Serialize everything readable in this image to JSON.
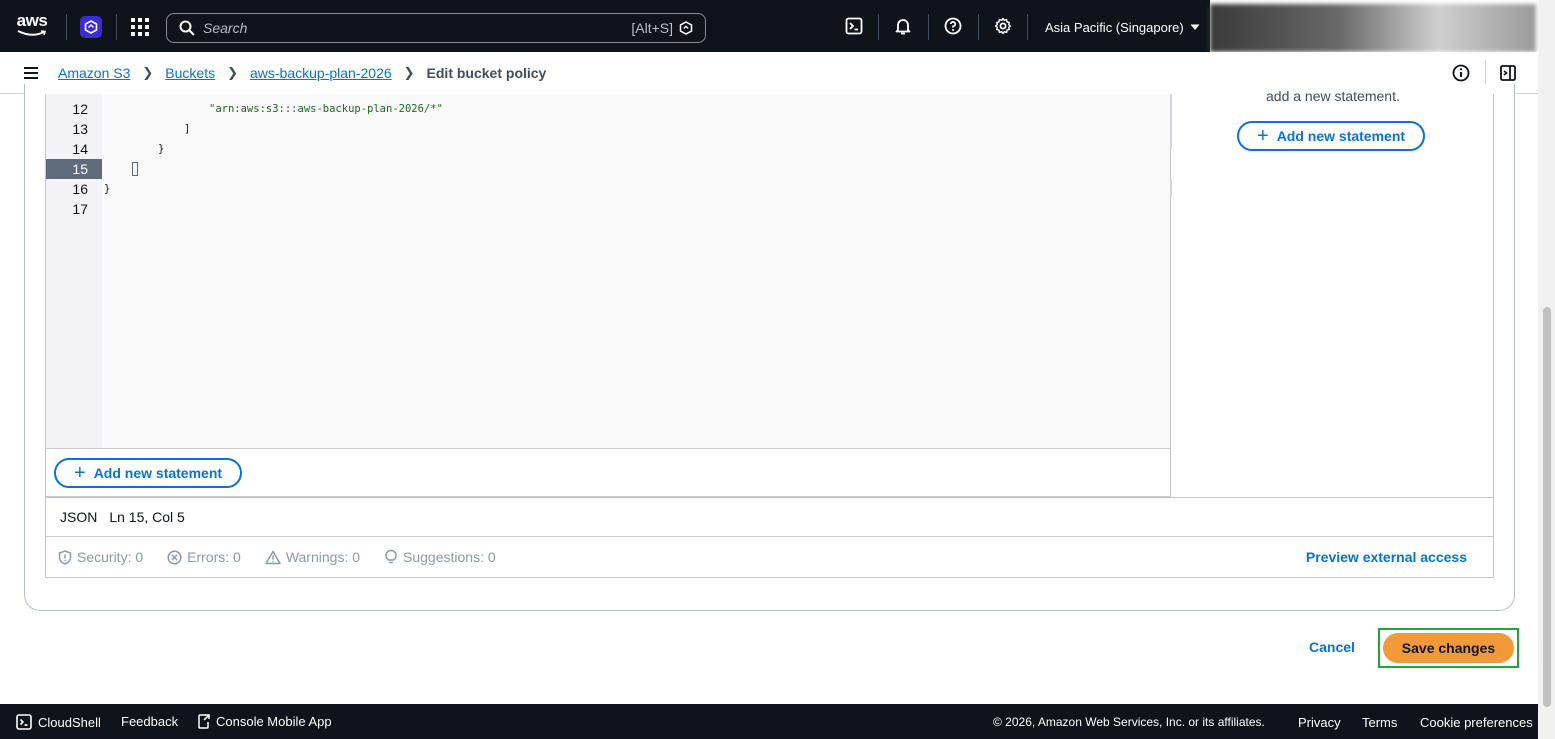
{
  "topnav": {
    "logo_text": "aws",
    "search_placeholder": "Search",
    "search_hint": "[Alt+S]",
    "region": "Asia Pacific (Singapore)"
  },
  "breadcrumb": {
    "items": [
      "Amazon S3",
      "Buckets",
      "aws-backup-plan-2026"
    ],
    "current": "Edit bucket policy"
  },
  "editor": {
    "lines": [
      {
        "num": "12",
        "text": "\"arn:aws:s3:::aws-backup-plan-2026/*\""
      },
      {
        "num": "13",
        "text": "]"
      },
      {
        "num": "14",
        "text": "}"
      },
      {
        "num": "15",
        "text": "]"
      },
      {
        "num": "16",
        "text": "}"
      },
      {
        "num": "17",
        "text": ""
      }
    ],
    "active_line": "15",
    "add_statement_label": "Add new statement"
  },
  "side_panel": {
    "text": "add a new statement.",
    "add_statement_label": "Add new statement"
  },
  "status": {
    "language": "JSON",
    "position": "Ln 15, Col 5"
  },
  "validation": {
    "security": "Security: 0",
    "errors": "Errors: 0",
    "warnings": "Warnings: 0",
    "suggestions": "Suggestions: 0",
    "preview_link": "Preview external access"
  },
  "actions": {
    "cancel": "Cancel",
    "save": "Save changes"
  },
  "footer": {
    "cloudshell": "CloudShell",
    "feedback": "Feedback",
    "mobile_app": "Console Mobile App",
    "copyright": "© 2026, Amazon Web Services, Inc. or its affiliates.",
    "privacy": "Privacy",
    "terms": "Terms",
    "cookies": "Cookie preferences"
  },
  "colors": {
    "nav_bg": "#0f141a",
    "link": "#0972d3",
    "primary_button": "#f29a3a",
    "highlight_frame": "#1fa53a"
  }
}
